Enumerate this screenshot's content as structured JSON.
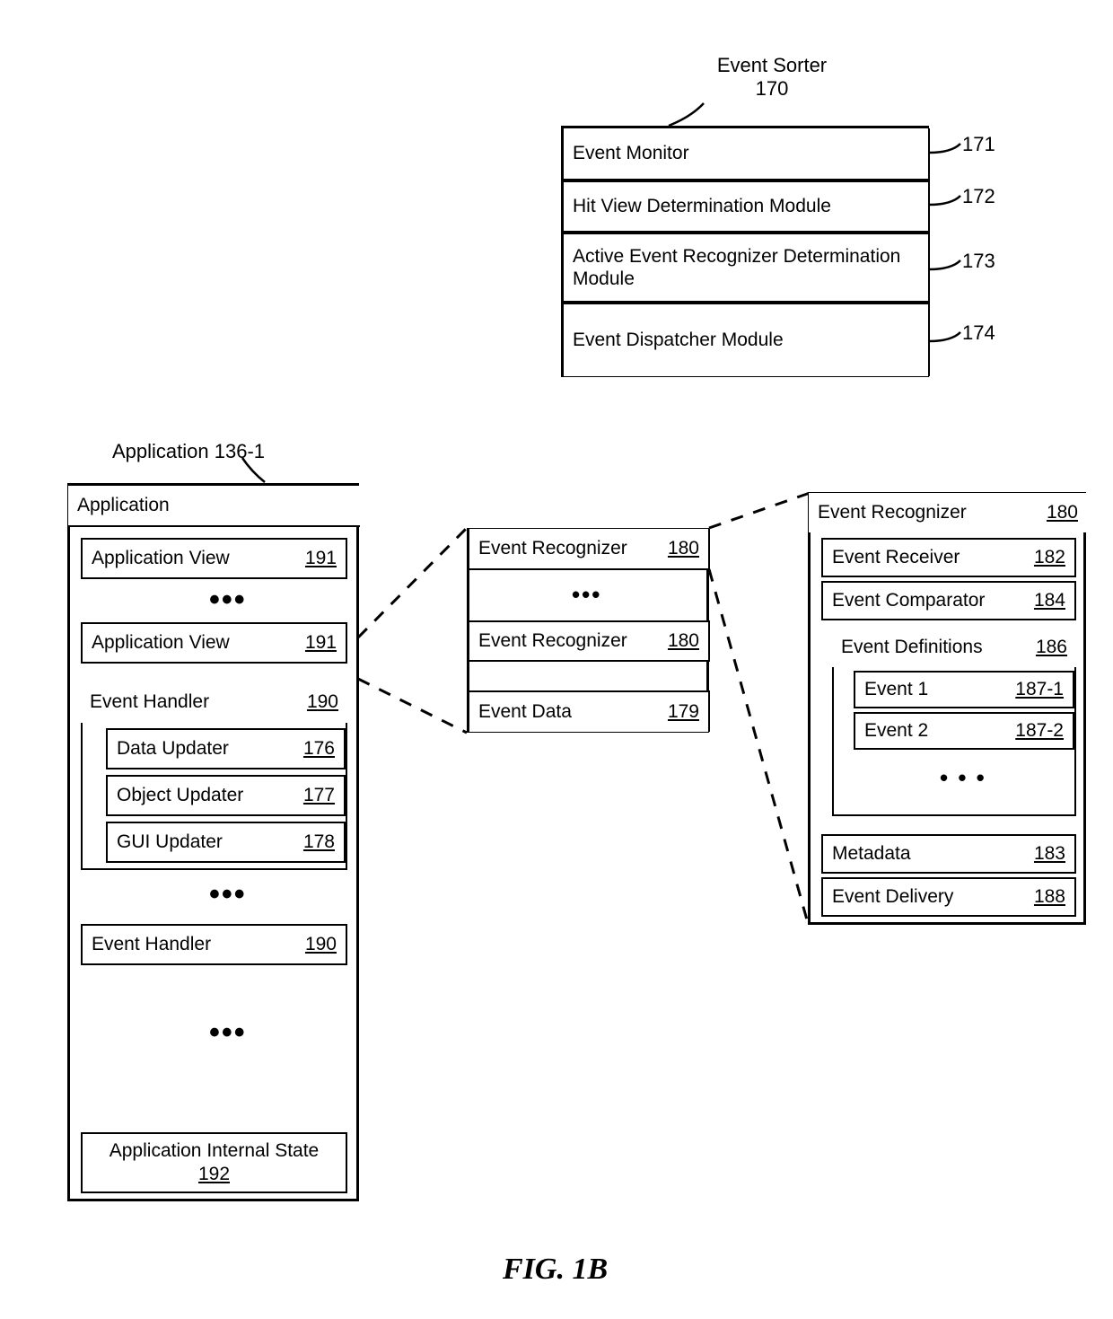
{
  "figure_label": "FIG. 1B",
  "event_sorter": {
    "title": "Event Sorter",
    "title_num": "170",
    "rows": [
      {
        "label": "Event Monitor",
        "tag": "171"
      },
      {
        "label": "Hit View Determination Module",
        "tag": "172"
      },
      {
        "label": "Active Event Recognizer Determination Module",
        "tag": "173"
      },
      {
        "label": "Event Dispatcher Module",
        "tag": "174"
      }
    ]
  },
  "application": {
    "lead_label": "Application 136-1",
    "header": "Application",
    "views": [
      {
        "label": "Application View",
        "num": "191"
      },
      {
        "label": "Application View",
        "num": "191"
      }
    ],
    "event_handler": {
      "label": "Event Handler",
      "num": "190",
      "children": [
        {
          "label": "Data Updater",
          "num": "176"
        },
        {
          "label": "Object Updater",
          "num": "177"
        },
        {
          "label": "GUI Updater",
          "num": "178"
        }
      ]
    },
    "event_handler2": {
      "label": "Event Handler",
      "num": "190"
    },
    "internal_state": {
      "label": "Application Internal State",
      "num": "192"
    }
  },
  "app_view_detail": {
    "rows": [
      {
        "label": "Event Recognizer",
        "num": "180"
      },
      {
        "label": "Event Recognizer",
        "num": "180"
      },
      {
        "label": "Event Data",
        "num": "179"
      }
    ]
  },
  "event_recognizer_detail": {
    "header": {
      "label": "Event Recognizer",
      "num": "180"
    },
    "rows_top": [
      {
        "label": "Event Receiver",
        "num": "182"
      },
      {
        "label": "Event Comparator",
        "num": "184"
      }
    ],
    "event_defs": {
      "label": "Event Definitions",
      "num": "186",
      "children": [
        {
          "label": "Event 1",
          "num": "187-1"
        },
        {
          "label": "Event 2",
          "num": "187-2"
        }
      ]
    },
    "rows_bottom": [
      {
        "label": "Metadata",
        "num": "183"
      },
      {
        "label": "Event Delivery",
        "num": "188"
      }
    ]
  }
}
